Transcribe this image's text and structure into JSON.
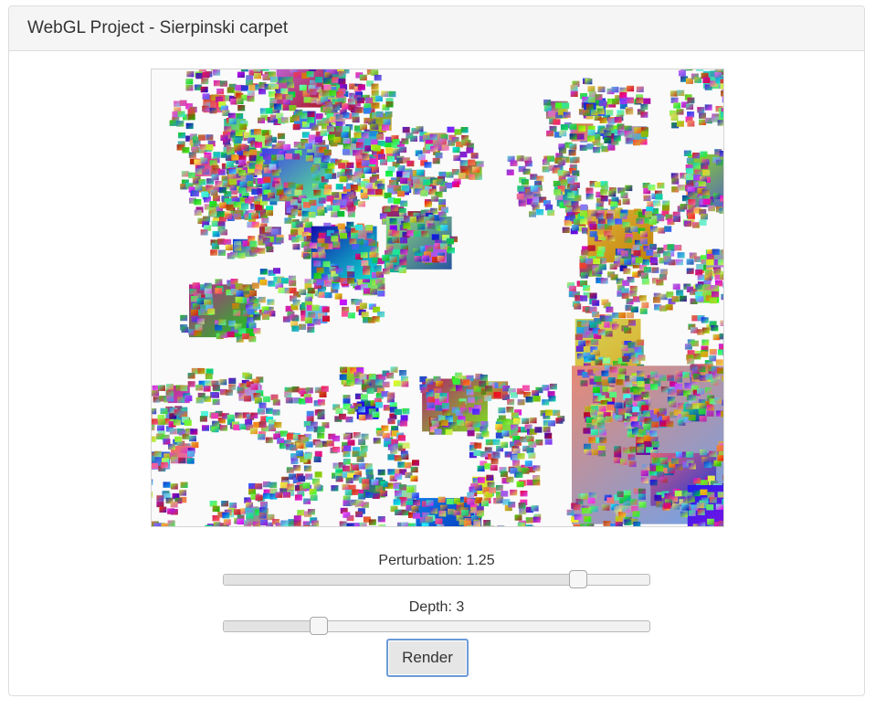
{
  "panel": {
    "title": "WebGL Project - Sierpinski carpet"
  },
  "canvas": {
    "name": "sierpinski-carpet-render",
    "background": "#fafafa"
  },
  "controls": {
    "perturbation": {
      "label": "Perturbation: 1.25",
      "value": 1.25,
      "fraction": 0.835
    },
    "depth": {
      "label": "Depth: 3",
      "value": 3,
      "fraction": 0.225
    },
    "render_button": {
      "label": "Render"
    }
  },
  "colors": {
    "panel_heading_bg": "#f5f5f5",
    "panel_border": "#dddddd",
    "button_focus_border": "#6c9ad8"
  }
}
